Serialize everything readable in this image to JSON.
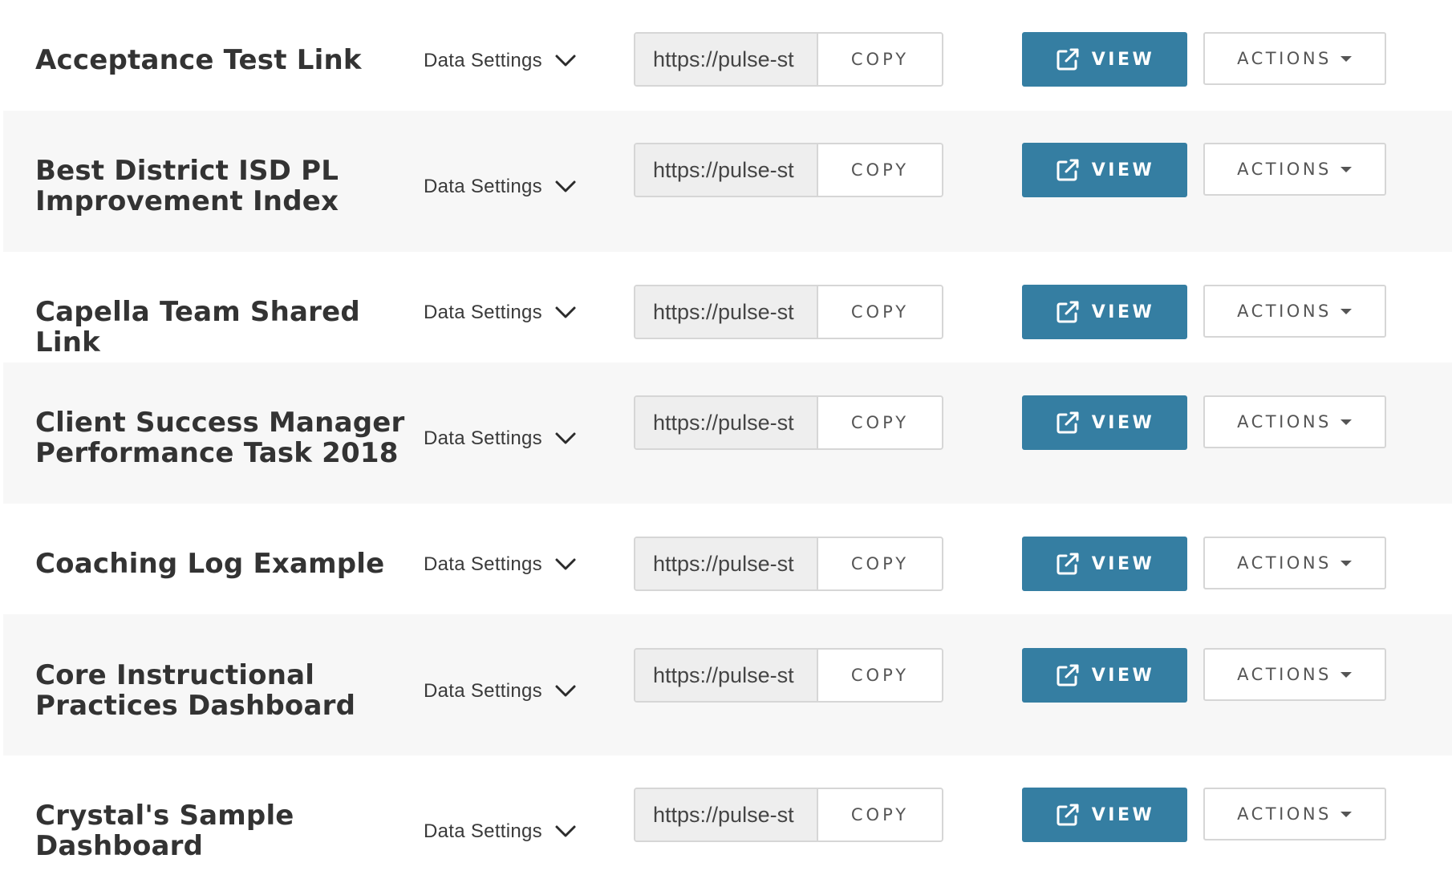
{
  "colors": {
    "view_button_bg": "#357ea2",
    "row_alt_bg": "#f7f7f7",
    "title_text": "#333333",
    "border": "#d6d6d6"
  },
  "icons": {
    "settings_chevron": "chevron-down-icon",
    "view": "external-link-icon",
    "actions_caret": "caret-down-icon"
  },
  "rows": [
    {
      "title": "Acceptance Test Link",
      "settings_label": "Data Settings",
      "url_value": "https://pulse-st",
      "copy_label": "COPY",
      "view_label": "VIEW",
      "actions_label": "ACTIONS"
    },
    {
      "title": "Best District ISD PL Improvement Index",
      "settings_label": "Data Settings",
      "url_value": "https://pulse-st",
      "copy_label": "COPY",
      "view_label": "VIEW",
      "actions_label": "ACTIONS"
    },
    {
      "title": "Capella Team Shared Link",
      "settings_label": "Data Settings",
      "url_value": "https://pulse-st",
      "copy_label": "COPY",
      "view_label": "VIEW",
      "actions_label": "ACTIONS"
    },
    {
      "title": "Client Success Manager Performance Task 2018",
      "settings_label": "Data Settings",
      "url_value": "https://pulse-st",
      "copy_label": "COPY",
      "view_label": "VIEW",
      "actions_label": "ACTIONS"
    },
    {
      "title": "Coaching Log Example",
      "settings_label": "Data Settings",
      "url_value": "https://pulse-st",
      "copy_label": "COPY",
      "view_label": "VIEW",
      "actions_label": "ACTIONS"
    },
    {
      "title": "Core Instructional Practices Dashboard",
      "settings_label": "Data Settings",
      "url_value": "https://pulse-st",
      "copy_label": "COPY",
      "view_label": "VIEW",
      "actions_label": "ACTIONS"
    },
    {
      "title": "Crystal's Sample Dashboard",
      "settings_label": "Data Settings",
      "url_value": "https://pulse-st",
      "copy_label": "COPY",
      "view_label": "VIEW",
      "actions_label": "ACTIONS"
    }
  ]
}
